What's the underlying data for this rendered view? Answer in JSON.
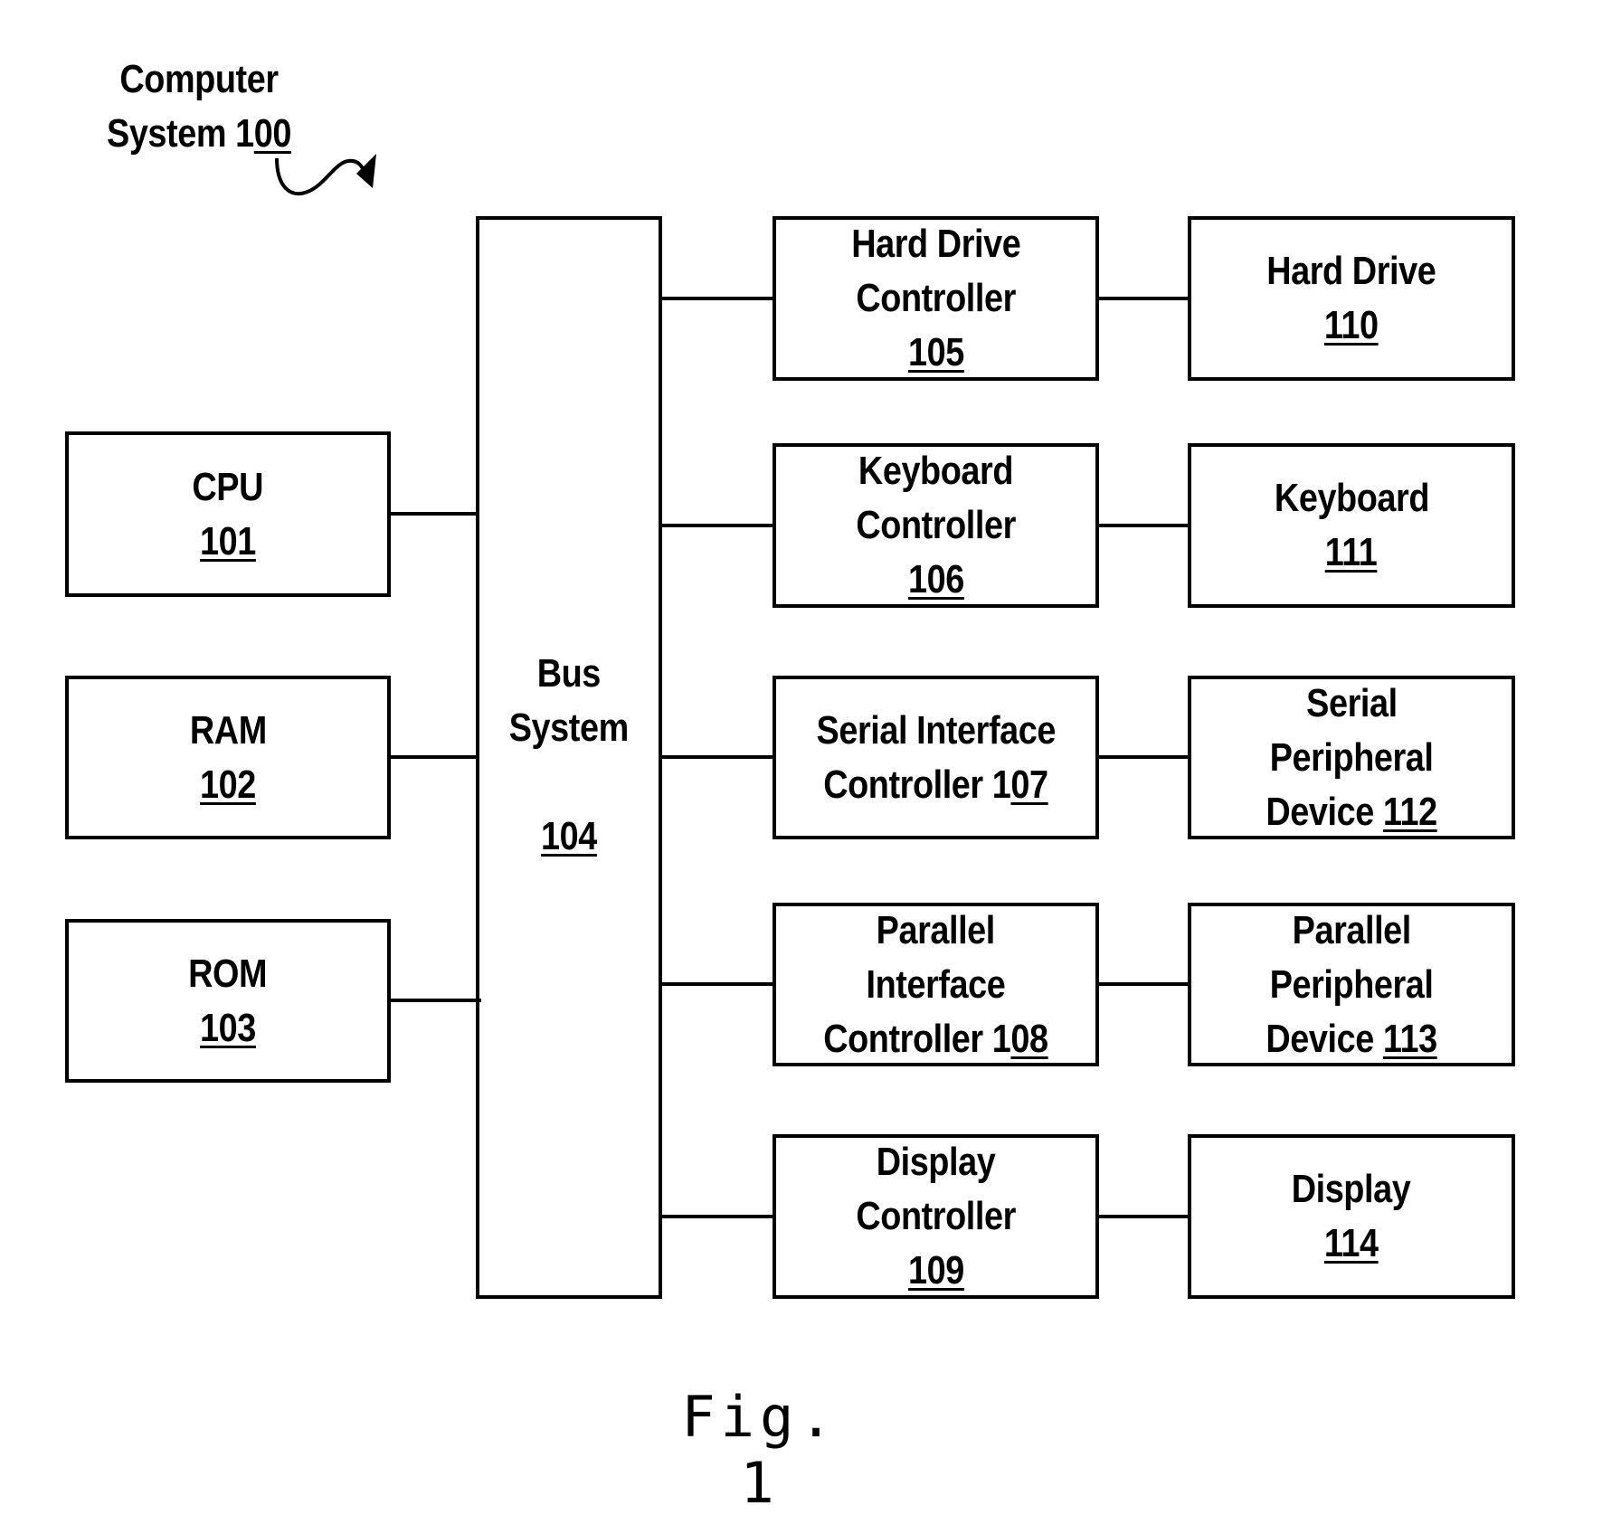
{
  "title": {
    "line1": "Computer",
    "line2_text": "System 1",
    "line2_ref": "00"
  },
  "figure_label": "Fig. 1",
  "bus": {
    "line1": "Bus",
    "line2": "System",
    "ref": "104"
  },
  "left_components": [
    {
      "name": "CPU",
      "ref": "101"
    },
    {
      "name": "RAM",
      "ref": "102"
    },
    {
      "name": "ROM",
      "ref": "103"
    }
  ],
  "controllers": [
    {
      "lines": [
        "Hard Drive",
        "Controller"
      ],
      "ref_prefix": "",
      "ref": "105",
      "ref_inline": false
    },
    {
      "lines": [
        "Keyboard",
        "Controller"
      ],
      "ref_prefix": "",
      "ref": "106",
      "ref_inline": false
    },
    {
      "lines": [
        "Serial Interface"
      ],
      "last_line": "Controller 1",
      "ref": "07",
      "ref_inline": true
    },
    {
      "lines": [
        "Parallel",
        "Interface"
      ],
      "last_line": "Controller 1",
      "ref": "08",
      "ref_inline": true
    },
    {
      "lines": [
        "Display",
        "Controller"
      ],
      "ref_prefix": "",
      "ref": "109",
      "ref_inline": false
    }
  ],
  "devices": [
    {
      "lines": [
        "Hard Drive"
      ],
      "ref": "110",
      "ref_inline": false
    },
    {
      "lines": [
        "Keyboard"
      ],
      "ref": "111",
      "ref_inline": false
    },
    {
      "lines": [
        "Serial",
        "Peripheral"
      ],
      "last_line": "Device ",
      "ref": "112",
      "ref_inline": true
    },
    {
      "lines": [
        "Parallel",
        "Peripheral"
      ],
      "last_line": "Device ",
      "ref": "113",
      "ref_inline": true
    },
    {
      "lines": [
        "Display"
      ],
      "ref": "114",
      "ref_inline": false
    }
  ]
}
